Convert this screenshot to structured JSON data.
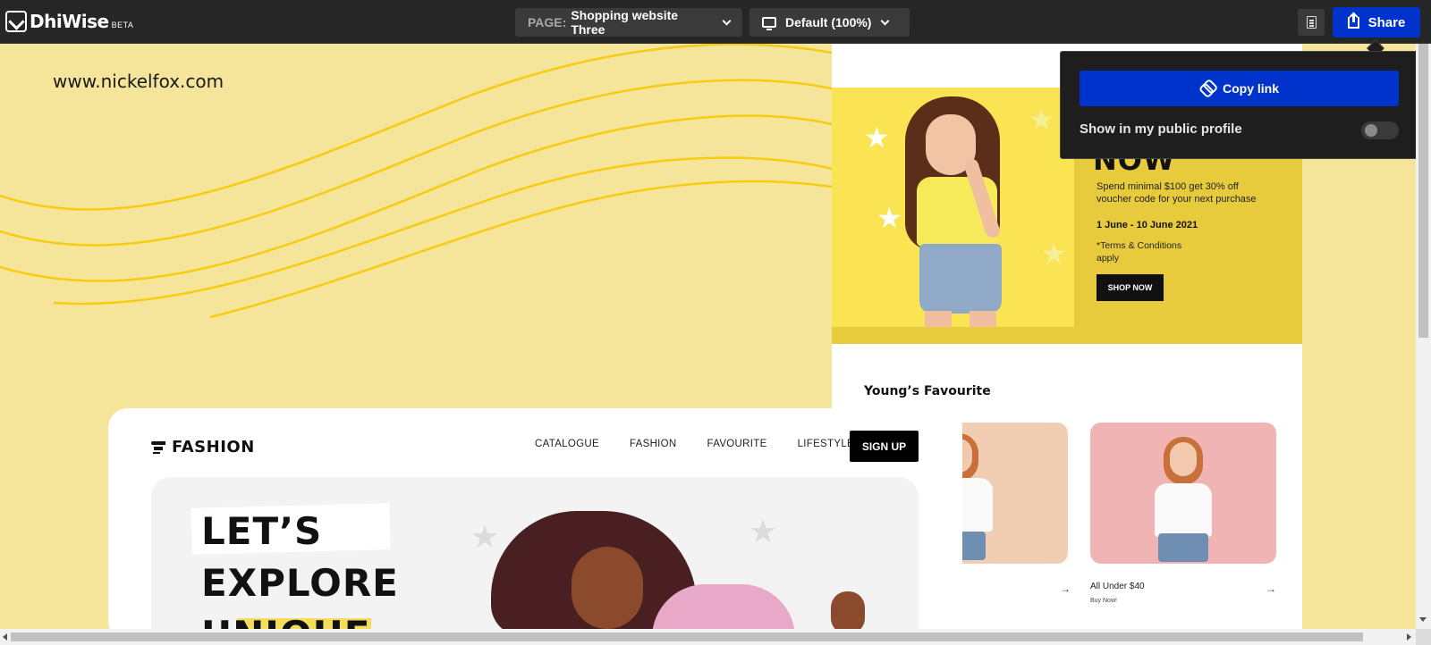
{
  "app": {
    "logo_text": "DhiWise",
    "beta_label": "BETA"
  },
  "toolbar": {
    "page_prefix": "PAGE:",
    "page_name": "Shopping website Three",
    "device_label": "Default (100%)",
    "share_label": "Share"
  },
  "share_popover": {
    "copy_link_label": "Copy link",
    "public_profile_label": "Show in my public profile",
    "public_profile_enabled": false
  },
  "canvas": {
    "site_url": "www.nickelfox.com",
    "promo": {
      "headline": "NOW",
      "description": "Spend minimal $100 get 30% off voucher code for your next purchase",
      "dates": "1 June - 10 June 2021",
      "terms": "*Terms & Conditions apply",
      "button": "SHOP NOW"
    },
    "favourites": {
      "title": "Young’s Favourite",
      "card_label": "All Under $40",
      "card_sub": "Buy Now!"
    },
    "fashion_site": {
      "brand": "FASHION",
      "nav": [
        "CATALOGUE",
        "FASHION",
        "FAVOURITE",
        "LIFESTYLE"
      ],
      "signup": "SIGN UP",
      "hero_line1": "LET’S",
      "hero_line2": "EXPLORE",
      "hero_line3": "UNIQUE"
    }
  },
  "colors": {
    "accent_blue": "#0033cc",
    "canvas_yellow": "#f4e59a",
    "topbar_bg": "#262626"
  }
}
